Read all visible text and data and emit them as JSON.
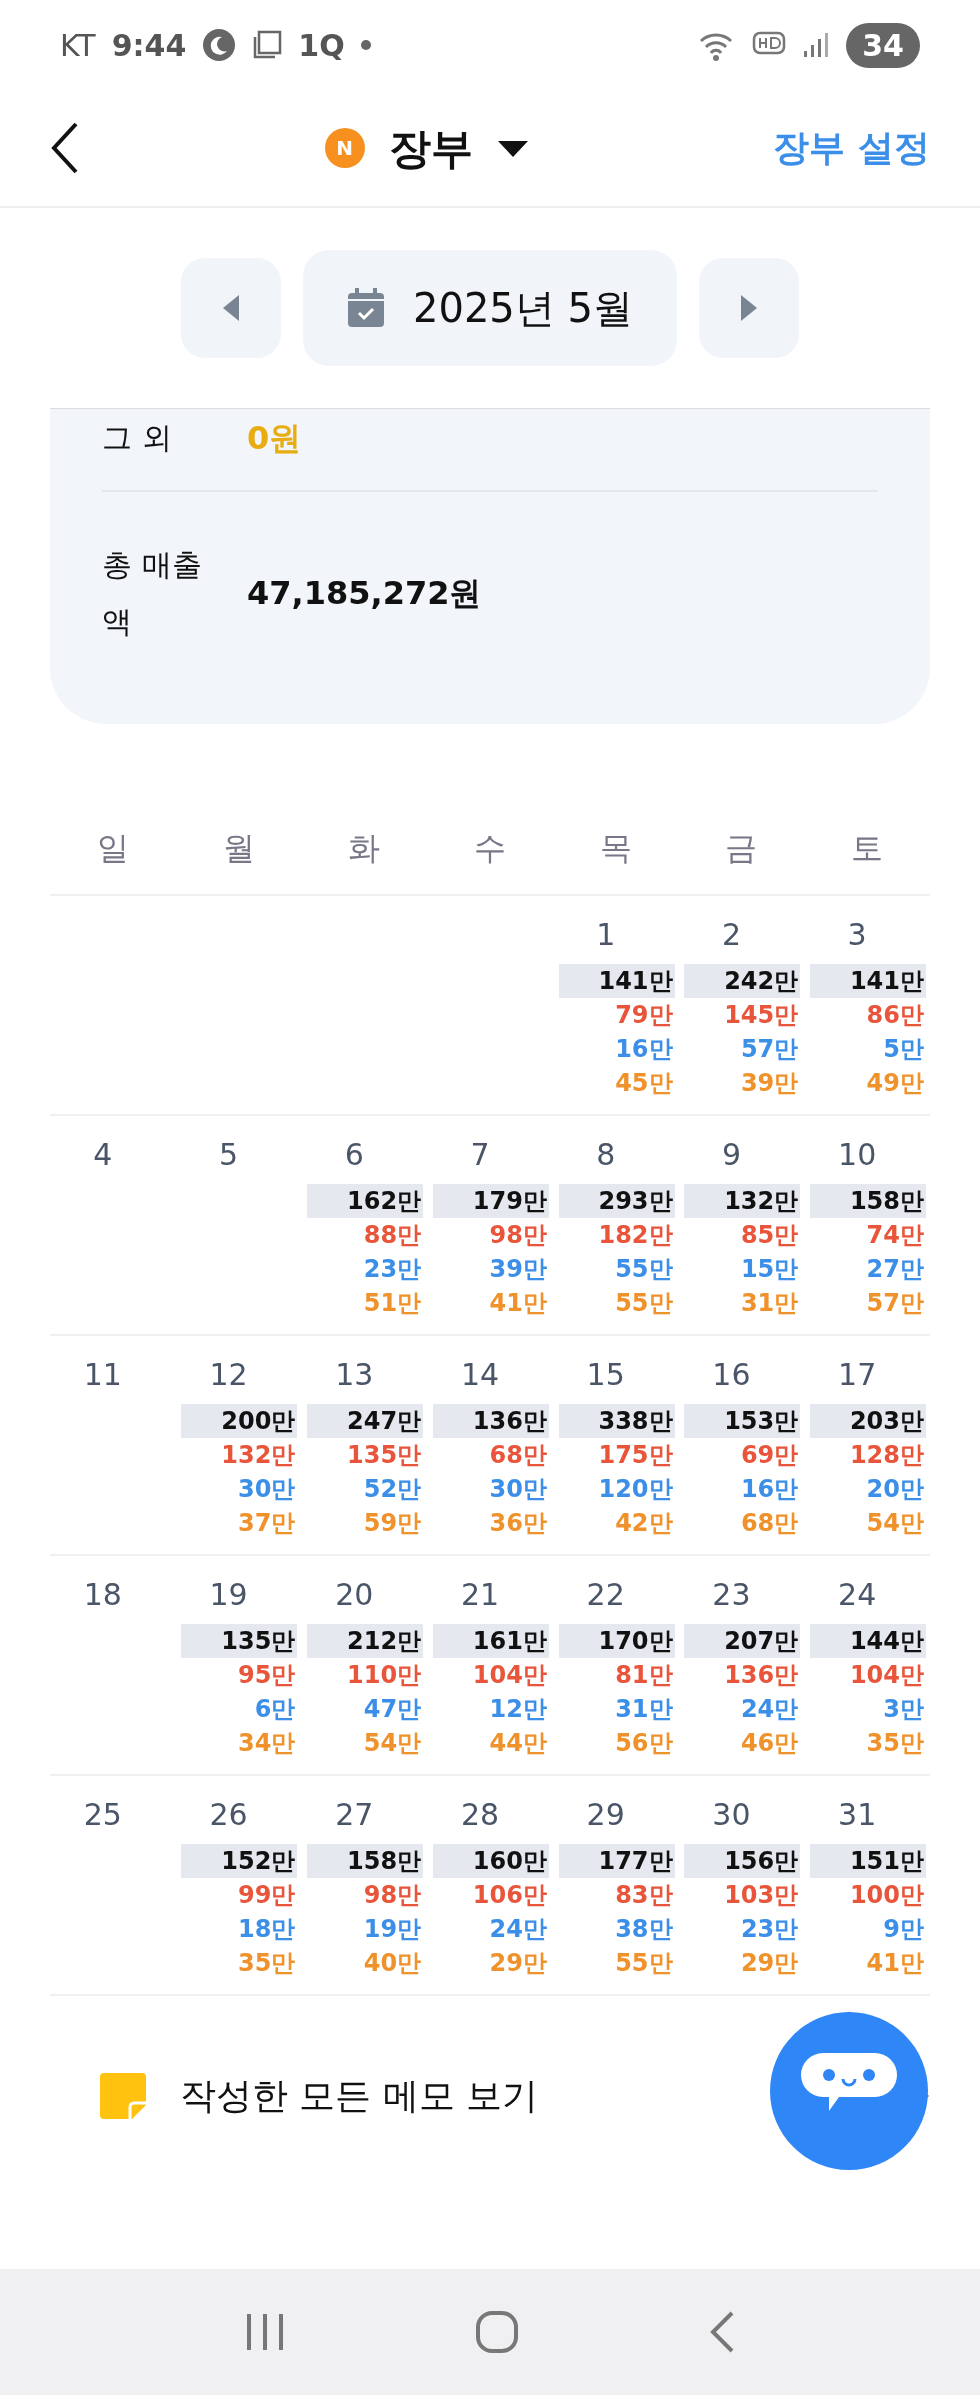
{
  "status_bar": {
    "carrier": "KT",
    "time": "9:44",
    "notification_text": "1Q",
    "battery": "34"
  },
  "header": {
    "ledger_badge": "N",
    "title": "장부",
    "settings_link": "장부 설정"
  },
  "month_nav": {
    "label": "2025년 5월"
  },
  "summary": {
    "rows": [
      {
        "label": "그 외",
        "value": "0원",
        "kind": "other"
      },
      {
        "label": "총 매출액",
        "value": "47,185,272원",
        "kind": "total"
      }
    ]
  },
  "calendar": {
    "weekdays": [
      "일",
      "월",
      "화",
      "수",
      "목",
      "금",
      "토"
    ],
    "amount_rows": [
      {
        "color": "#111111"
      },
      {
        "color": "#e8553a"
      },
      {
        "color": "#3b8fe8"
      },
      {
        "color": "#f0922b"
      }
    ],
    "weeks": [
      [
        {
          "date": "1",
          "amounts": [
            "141만",
            "79만",
            "16만",
            "45만"
          ]
        },
        {
          "date": "2",
          "amounts": [
            "242만",
            "145만",
            "57만",
            "39만"
          ]
        },
        {
          "date": "3",
          "amounts": [
            "141만",
            "86만",
            "5만",
            "49만"
          ]
        }
      ],
      [
        {
          "date": "4"
        },
        {
          "date": "5"
        },
        {
          "date": "6",
          "amounts": [
            "162만",
            "88만",
            "23만",
            "51만"
          ]
        },
        {
          "date": "7",
          "amounts": [
            "179만",
            "98만",
            "39만",
            "41만"
          ]
        },
        {
          "date": "8",
          "amounts": [
            "293만",
            "182만",
            "55만",
            "55만"
          ]
        },
        {
          "date": "9",
          "amounts": [
            "132만",
            "85만",
            "15만",
            "31만"
          ]
        },
        {
          "date": "10",
          "amounts": [
            "158만",
            "74만",
            "27만",
            "57만"
          ]
        }
      ],
      [
        {
          "date": "11"
        },
        {
          "date": "12",
          "amounts": [
            "200만",
            "132만",
            "30만",
            "37만"
          ]
        },
        {
          "date": "13",
          "amounts": [
            "247만",
            "135만",
            "52만",
            "59만"
          ]
        },
        {
          "date": "14",
          "amounts": [
            "136만",
            "68만",
            "30만",
            "36만"
          ]
        },
        {
          "date": "15",
          "amounts": [
            "338만",
            "175만",
            "120만",
            "42만"
          ]
        },
        {
          "date": "16",
          "amounts": [
            "153만",
            "69만",
            "16만",
            "68만"
          ]
        },
        {
          "date": "17",
          "amounts": [
            "203만",
            "128만",
            "20만",
            "54만"
          ]
        }
      ],
      [
        {
          "date": "18"
        },
        {
          "date": "19",
          "amounts": [
            "135만",
            "95만",
            "6만",
            "34만"
          ]
        },
        {
          "date": "20",
          "amounts": [
            "212만",
            "110만",
            "47만",
            "54만"
          ]
        },
        {
          "date": "21",
          "amounts": [
            "161만",
            "104만",
            "12만",
            "44만"
          ]
        },
        {
          "date": "22",
          "amounts": [
            "170만",
            "81만",
            "31만",
            "56만"
          ]
        },
        {
          "date": "23",
          "amounts": [
            "207만",
            "136만",
            "24만",
            "46만"
          ]
        },
        {
          "date": "24",
          "amounts": [
            "144만",
            "104만",
            "3만",
            "35만"
          ]
        }
      ],
      [
        {
          "date": "25"
        },
        {
          "date": "26",
          "amounts": [
            "152만",
            "99만",
            "18만",
            "35만"
          ]
        },
        {
          "date": "27",
          "amounts": [
            "158만",
            "98만",
            "19만",
            "40만"
          ]
        },
        {
          "date": "28",
          "amounts": [
            "160만",
            "106만",
            "24만",
            "29만"
          ]
        },
        {
          "date": "29",
          "amounts": [
            "177만",
            "83만",
            "38만",
            "55만"
          ]
        },
        {
          "date": "30",
          "amounts": [
            "156만",
            "103만",
            "23만",
            "29만"
          ]
        },
        {
          "date": "31",
          "amounts": [
            "151만",
            "100만",
            "9만",
            "41만"
          ]
        }
      ]
    ]
  },
  "memo_link": {
    "label": "작성한 모든 메모 보기"
  }
}
